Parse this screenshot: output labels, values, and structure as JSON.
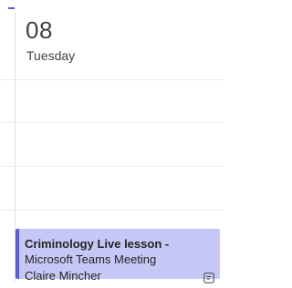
{
  "calendar": {
    "day": {
      "date_number": "08",
      "weekday": "Tuesday"
    },
    "event": {
      "title": "Criminology Live lesson -",
      "location": "Microsoft Teams Meeting",
      "organizer": "Claire Mincher",
      "icon": "meeting-notes-icon"
    }
  },
  "colors": {
    "event_background": "#c5c8f5",
    "event_accent": "#5b5fc7"
  }
}
